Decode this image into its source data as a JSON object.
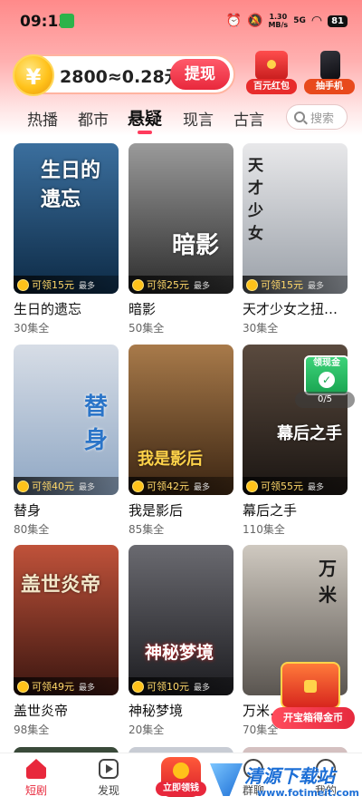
{
  "status_bar": {
    "time": "09:13",
    "net_speed_value": "1.30",
    "net_speed_unit": "MB/s",
    "signal": "5G",
    "battery": "81"
  },
  "header": {
    "coin_text": "2800≈0.28元",
    "coin_symbol": "¥",
    "withdraw_label": "提现",
    "promos": [
      {
        "label": "百元红包",
        "icon": "red-envelope-icon"
      },
      {
        "label": "抽手机",
        "icon": "phone-icon"
      }
    ]
  },
  "tabs": [
    {
      "label": "热播",
      "active": false
    },
    {
      "label": "都市",
      "active": false
    },
    {
      "label": "悬疑",
      "active": true
    },
    {
      "label": "现言",
      "active": false
    },
    {
      "label": "古言",
      "active": false
    }
  ],
  "search": {
    "placeholder": "搜索"
  },
  "cards": [
    {
      "title": "生日的遗忘",
      "episodes": "30集全",
      "reward": "可领15元",
      "more": "最多",
      "poster_text": "生日的遗忘",
      "colors": [
        "#3b6f9e",
        "#0d2a45"
      ]
    },
    {
      "title": "暗影",
      "episodes": "50集全",
      "reward": "可领25元",
      "more": "最多",
      "poster_text": "暗影",
      "colors": [
        "#9a9a9a",
        "#2c2c2c"
      ]
    },
    {
      "title": "天才少女之扭…",
      "episodes": "30集全",
      "reward": "可领15元",
      "more": "最多",
      "poster_text": "天才少女",
      "colors": [
        "#e8e8ea",
        "#9aa0a8"
      ]
    },
    {
      "title": "替身",
      "episodes": "80集全",
      "reward": "可领40元",
      "more": "最多",
      "poster_text": "替身",
      "colors": [
        "#d7dde6",
        "#8fa7c4"
      ]
    },
    {
      "title": "我是影后",
      "episodes": "85集全",
      "reward": "可领42元",
      "more": "最多",
      "poster_text": "我是影后",
      "colors": [
        "#a87a4a",
        "#3b2512"
      ]
    },
    {
      "title": "幕后之手",
      "episodes": "110集全",
      "reward": "可领55元",
      "more": "最多",
      "poster_text": "幕后之手",
      "colors": [
        "#5a4a3e",
        "#1a1512"
      ]
    },
    {
      "title": "盖世炎帝",
      "episodes": "98集全",
      "reward": "可领49元",
      "more": "最多",
      "poster_text": "盖世炎帝",
      "colors": [
        "#c0523a",
        "#3a1610"
      ]
    },
    {
      "title": "神秘梦境",
      "episodes": "20集全",
      "reward": "可领10元",
      "more": "最多",
      "poster_text": "神秘梦境",
      "colors": [
        "#6a6a70",
        "#1c1c20"
      ]
    },
    {
      "title": "万米…",
      "episodes": "70集全",
      "reward": "",
      "more": "最多",
      "poster_text": "万米",
      "colors": [
        "#cfc9c0",
        "#5a5550"
      ]
    }
  ],
  "floating": {
    "red_envelope_label": "领现金",
    "progress": "0/5",
    "chest_button": "开宝箱得金币"
  },
  "bottom_nav": [
    {
      "label": "短剧",
      "icon": "home-icon",
      "active": true
    },
    {
      "label": "发现",
      "icon": "play-icon",
      "active": false
    },
    {
      "label": "立即领钱",
      "icon": "withdraw-coin-icon",
      "active": false
    },
    {
      "label": "群聊",
      "icon": "group-chat-icon",
      "active": false
    },
    {
      "label": "我的",
      "icon": "profile-icon",
      "active": false
    }
  ],
  "watermark": {
    "title": "清源下载站",
    "url": "www.fotimeit.com"
  }
}
